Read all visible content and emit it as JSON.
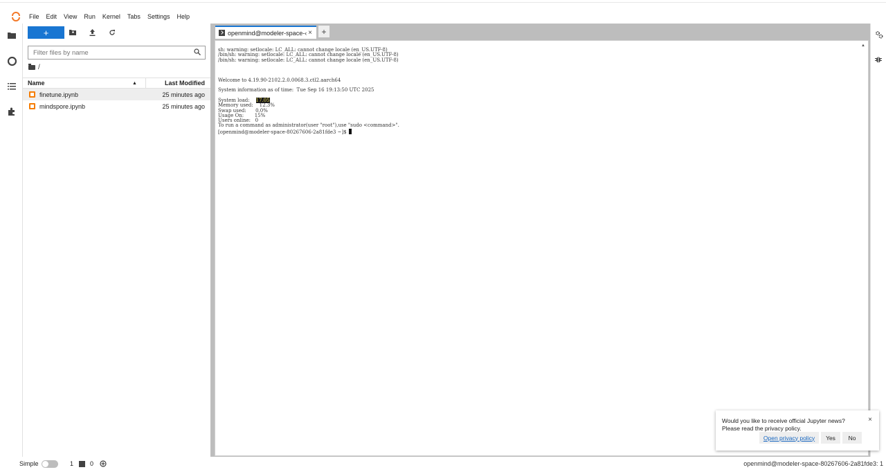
{
  "menubar": {
    "items": [
      "File",
      "Edit",
      "View",
      "Run",
      "Kernel",
      "Tabs",
      "Settings",
      "Help"
    ]
  },
  "filebrowser": {
    "new_label": "+",
    "filter_placeholder": "Filter files by name",
    "breadcrumb": "/",
    "columns": {
      "name": "Name",
      "modified": "Last Modified"
    },
    "files": [
      {
        "name": "finetune.ipynb",
        "modified": "25 minutes ago",
        "selected": true
      },
      {
        "name": "mindspore.ipynb",
        "modified": "25 minutes ago",
        "selected": false
      }
    ]
  },
  "tabs": [
    {
      "label": "openmind@modeler-space-‹",
      "close": "×"
    }
  ],
  "tab_add": "+",
  "terminal": {
    "lines": [
      "sh: warning: setlocale: LC_ALL: cannot change locale (en_US.UTF-8)",
      "/bin/sh: warning: setlocale: LC_ALL: cannot change locale (en_US.UTF-8)",
      "/bin/sh: warning: setlocale: LC_ALL: cannot change locale (en_US.UTF-8)",
      "",
      "",
      "",
      "Welcome to 4.19.90-2102.2.0.0068.3.ctl2.aarch64",
      "",
      "System information as of time:  Tue Sep 16 19:13:50 UTC 2025",
      "",
      "System load:    ",
      "Memory used:    12.3%",
      "Swap used:      0.0%",
      "Usage On:       15%",
      "Users online:   0",
      "To run a command as administrator(user \"root\"),use \"sudo <command>\".",
      "[openmind@modeler-space-80267606-2a81fde3 ~]$"
    ],
    "system_load_value": "17.05"
  },
  "statusbar": {
    "mode_label": "Simple",
    "terminals_count": "1",
    "kernels_count": "0",
    "right_text": "openmind@modeler-space-80267606-2a81fde3: 1"
  },
  "notification": {
    "line1": "Would you like to receive official Jupyter news?",
    "line2": "Please read the privacy policy.",
    "link_label": "Open privacy policy",
    "yes_label": "Yes",
    "no_label": "No",
    "close": "×"
  },
  "colors": {
    "accent": "#1976d2",
    "logo": "#f37726",
    "notebook_icon": "#f57c00",
    "terminal_highlight_bg": "#1a1a1a",
    "terminal_highlight_fg": "#e6d84c"
  }
}
